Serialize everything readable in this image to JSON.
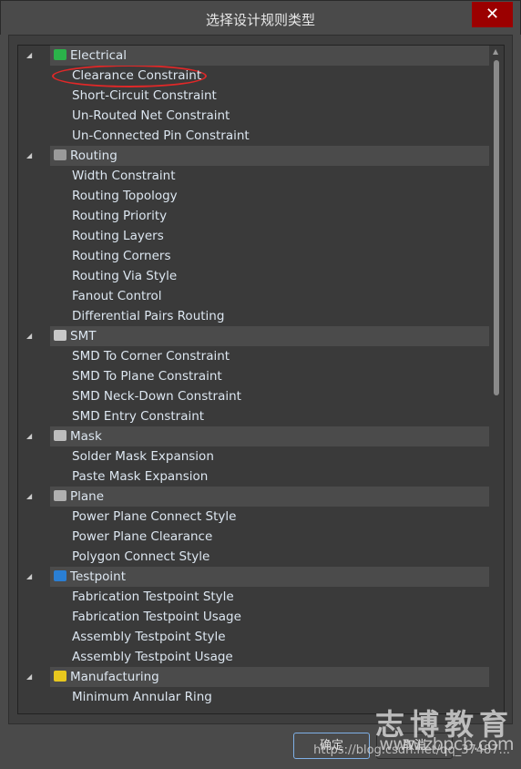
{
  "window": {
    "title": "选择设计规则类型",
    "close_icon": "close-icon"
  },
  "tree": [
    {
      "label": "Electrical",
      "icon": "electrical-icon",
      "color": "#2bb34a",
      "items": [
        "Clearance Constraint",
        "Short-Circuit Constraint",
        "Un-Routed Net Constraint",
        "Un-Connected Pin Constraint"
      ]
    },
    {
      "label": "Routing",
      "icon": "routing-icon",
      "color": "#9a9a9a",
      "items": [
        "Width Constraint",
        "Routing Topology",
        "Routing Priority",
        "Routing Layers",
        "Routing Corners",
        "Routing Via Style",
        "Fanout Control",
        "Differential Pairs Routing"
      ]
    },
    {
      "label": "SMT",
      "icon": "smt-icon",
      "color": "#c8c8c8",
      "items": [
        "SMD To Corner Constraint",
        "SMD To Plane Constraint",
        "SMD Neck-Down Constraint",
        "SMD Entry Constraint"
      ]
    },
    {
      "label": "Mask",
      "icon": "mask-icon",
      "color": "#bdbdbd",
      "items": [
        "Solder Mask Expansion",
        "Paste Mask Expansion"
      ]
    },
    {
      "label": "Plane",
      "icon": "plane-icon",
      "color": "#b0b0b0",
      "items": [
        "Power Plane Connect Style",
        "Power Plane Clearance",
        "Polygon Connect Style"
      ]
    },
    {
      "label": "Testpoint",
      "icon": "testpoint-icon",
      "color": "#2a7fd4",
      "items": [
        "Fabrication Testpoint Style",
        "Fabrication Testpoint Usage",
        "Assembly Testpoint Style",
        "Assembly Testpoint Usage"
      ]
    },
    {
      "label": "Manufacturing",
      "icon": "manufacturing-icon",
      "color": "#e8c81e",
      "items": [
        "Minimum Annular Ring"
      ]
    }
  ],
  "buttons": {
    "ok": "确定",
    "cancel": "取消"
  },
  "watermark": {
    "brand": "志博教育",
    "site": "www.zbpcb.com",
    "blog": "https://blog.csdn.net/qq_37487..."
  },
  "highlight_color": "#e02828"
}
